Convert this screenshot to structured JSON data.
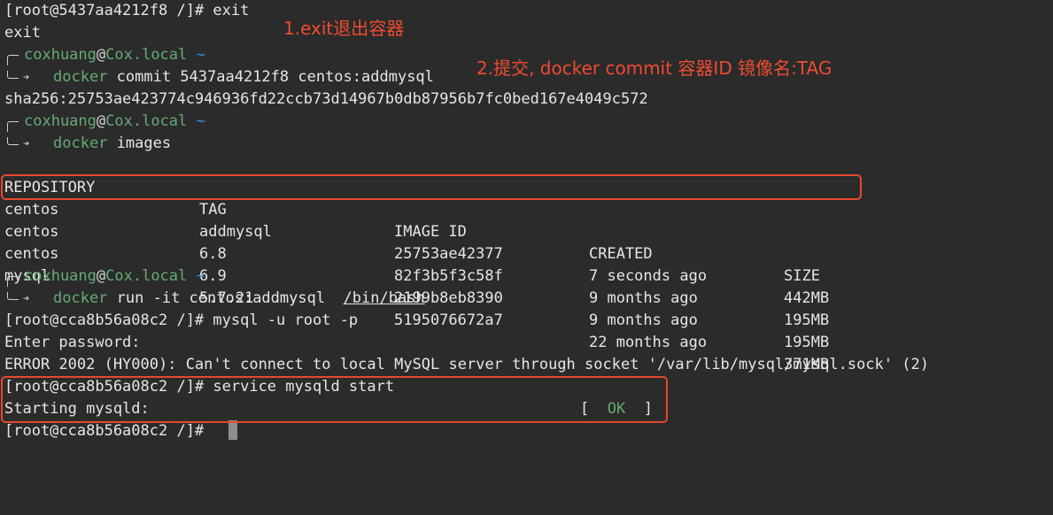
{
  "lines": {
    "l1": "[root@5437aa4212f8 /]# exit",
    "l2": "exit",
    "sha": "sha256:25753ae423774c946936fd22ccb73d14967b0db87956b7fc0bed167e4049c572",
    "mysql_cmd": "[root@cca8b56a08c2 /]# mysql -u root -p",
    "enter_pw": "Enter password:",
    "error": "ERROR 2002 (HY000): Can't connect to local MySQL server through socket '/var/lib/mysql/mysql.sock' (2)",
    "service_cmd": "[root@cca8b56a08c2 /]# service mysqld start",
    "starting": "Starting mysqld:",
    "ok_open": "[",
    "ok": "OK",
    "ok_close": "]",
    "last_prompt": "[root@cca8b56a08c2 /]# "
  },
  "prompt": {
    "user": "coxhuang",
    "at": "@",
    "host": "Cox.local",
    "tilde": "~",
    "arrow": "➔"
  },
  "commands": {
    "c1_cmd": "docker",
    "c1_args": "commit 5437aa4212f8 centos:addmysql",
    "c2_cmd": "docker",
    "c2_args": "images",
    "c3_cmd": "docker",
    "c3_args": "run -it centos:addmysql  ",
    "c3_path": "/bin/bash"
  },
  "table": {
    "headers": [
      "REPOSITORY",
      "TAG",
      "IMAGE ID",
      "CREATED",
      "SIZE"
    ],
    "rows": [
      [
        "centos",
        "addmysql",
        "25753ae42377",
        "7 seconds ago",
        "442MB"
      ],
      [
        "centos",
        "6.8",
        "82f3b5f3c58f",
        "9 months ago",
        "195MB"
      ],
      [
        "centos",
        "6.9",
        "2199b8eb8390",
        "9 months ago",
        "195MB"
      ],
      [
        "mysql",
        "5.7.21",
        "5195076672a7",
        "22 months ago",
        "371MB"
      ]
    ]
  },
  "annotations": {
    "a1": "1.exit退出容器",
    "a2": "2.提交, docker commit 容器ID 镜像名:TAG"
  },
  "colors": {
    "background": "#2b2b2b",
    "annotation": "#ef4b32",
    "prompt_green": "#66aa77",
    "tilde_blue": "#3f8fd8"
  }
}
